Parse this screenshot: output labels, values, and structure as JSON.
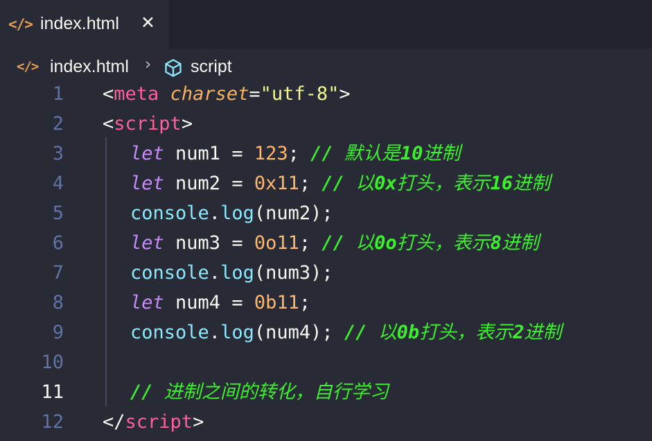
{
  "tab": {
    "icon": "</>",
    "label": "index.html",
    "close": "✕"
  },
  "breadcrumb": {
    "icon": "</>",
    "file": "index.html",
    "separator": "›",
    "symbol_icon": "cube-symbol-icon",
    "symbol": "script"
  },
  "colors": {
    "background": "#282a36",
    "tag": "#ff5f9a",
    "keyword": "#c78bf9",
    "number": "#ffb86c",
    "comment": "#3af02a",
    "string": "#f1fa8c",
    "object": "#8be9fd",
    "line_number": "#6272a4"
  },
  "editor": {
    "active_line": 11,
    "lines": [
      {
        "n": "1"
      },
      {
        "n": "2"
      },
      {
        "n": "3"
      },
      {
        "n": "4"
      },
      {
        "n": "5"
      },
      {
        "n": "6"
      },
      {
        "n": "7"
      },
      {
        "n": "8"
      },
      {
        "n": "9"
      },
      {
        "n": "10"
      },
      {
        "n": "11"
      },
      {
        "n": "12"
      }
    ],
    "code": {
      "l1": {
        "lt": "<",
        "tag": "meta",
        "attr": "charset",
        "eq": "=",
        "str": "\"utf-8\"",
        "gt": ">"
      },
      "l2": {
        "lt": "<",
        "tag": "script",
        "gt": ">"
      },
      "l3": {
        "kw": "let",
        "ident": " num1 = ",
        "num": "123",
        "semi": "; ",
        "slash": "// ",
        "c1": "默认是",
        "c2": "10",
        "c3": "进制"
      },
      "l4": {
        "kw": "let",
        "ident": " num2 = ",
        "num": "0x11",
        "semi": "; ",
        "slash": "// ",
        "c1": "以",
        "c2": "0x",
        "c3": "打头，表示",
        "c4": "16",
        "c5": "进制"
      },
      "l5": {
        "obj": "console",
        "dot": ".",
        "fn": "log",
        "rest": "(num2);"
      },
      "l6": {
        "kw": "let",
        "ident": " num3 = ",
        "num": "0o11",
        "semi": "; ",
        "slash": "// ",
        "c1": "以",
        "c2": "0o",
        "c3": "打头，表示",
        "c4": "8",
        "c5": "进制"
      },
      "l7": {
        "obj": "console",
        "dot": ".",
        "fn": "log",
        "rest": "(num3);"
      },
      "l8": {
        "kw": "let",
        "ident": " num4 = ",
        "num": "0b11",
        "semi": ";"
      },
      "l9": {
        "obj": "console",
        "dot": ".",
        "fn": "log",
        "rest": "(num4); ",
        "slash": "// ",
        "c1": "以",
        "c2": "0b",
        "c3": "打头，表示",
        "c4": "2",
        "c5": "进制"
      },
      "l11": {
        "slash": "// ",
        "c1": "进制之间的转化，自行学习"
      },
      "l12": {
        "lt": "</",
        "tag": "script",
        "gt": ">"
      }
    }
  }
}
